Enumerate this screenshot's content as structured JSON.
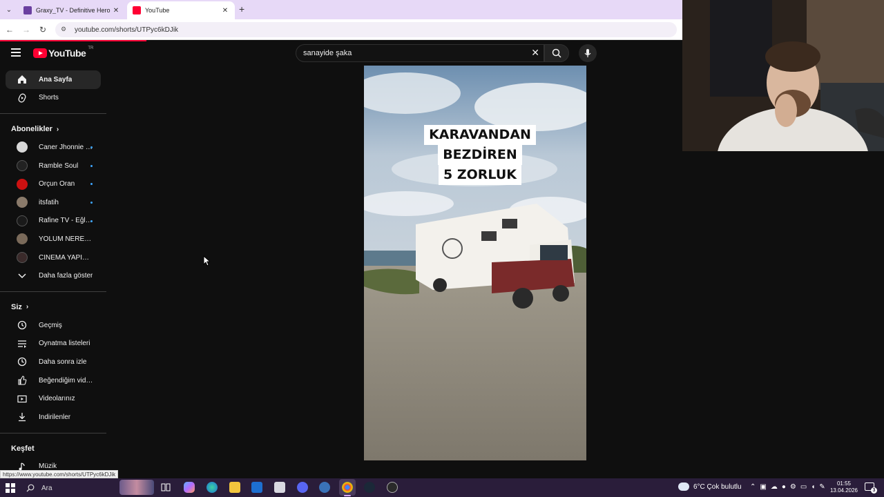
{
  "browser": {
    "tabs": [
      {
        "title": "Graxy_TV - Definitive Hero Siege",
        "active": false,
        "favicon_color": "#6a3fa0"
      },
      {
        "title": "YouTube",
        "active": true,
        "favicon_color": "#ff0033"
      }
    ],
    "url": "youtube.com/shorts/UTPyc6kDJik",
    "status_url": "https://www.youtube.com/shorts/UTPyc6kDJik"
  },
  "youtube": {
    "logo_text": "YouTube",
    "country_code": "TR",
    "search_value": "sanayide şaka"
  },
  "sidebar": {
    "main": [
      {
        "label": "Ana Sayfa",
        "icon": "home-icon",
        "active": true
      },
      {
        "label": "Shorts",
        "icon": "shorts-icon",
        "active": false
      }
    ],
    "subscriptions_title": "Abonelikler",
    "subscriptions": [
      {
        "label": "Caner Jhonnie G...",
        "color": "#d8d8d8"
      },
      {
        "label": "Ramble Soul",
        "color": "#222222"
      },
      {
        "label": "Orçun Oran",
        "color": "#cc1111"
      },
      {
        "label": "itsfatih",
        "color": "#8a7a6a"
      },
      {
        "label": "Rafine TV - Eğlen...",
        "color": "#1a1a1a"
      },
      {
        "label": "YOLUM NEREYE & ...",
        "color": "#7a6a5a"
      },
      {
        "label": "CİNEMA YAPİM🎬",
        "color": "#3a2a2a"
      }
    ],
    "show_more": "Daha fazla göster",
    "you_title": "Siz",
    "you": [
      {
        "label": "Geçmiş",
        "icon": "history-icon"
      },
      {
        "label": "Oynatma listeleri",
        "icon": "playlist-icon"
      },
      {
        "label": "Daha sonra izle",
        "icon": "clock-icon"
      },
      {
        "label": "Beğendiğim videolar",
        "icon": "like-icon"
      },
      {
        "label": "Videolarınız",
        "icon": "video-icon"
      },
      {
        "label": "İndirilenler",
        "icon": "download-icon"
      }
    ],
    "explore_title": "Keşfet",
    "explore": [
      {
        "label": "Müzik",
        "icon": "music-icon"
      }
    ]
  },
  "short": {
    "overlay_lines": [
      "KARAVANDAN",
      "BEZDİREN",
      "5 ZORLUK"
    ]
  },
  "taskbar": {
    "search_label": "Ara",
    "weather": "6°C  Çok bulutlu",
    "time": "01:55",
    "date": "13.04.2026",
    "notification_count": "3"
  }
}
